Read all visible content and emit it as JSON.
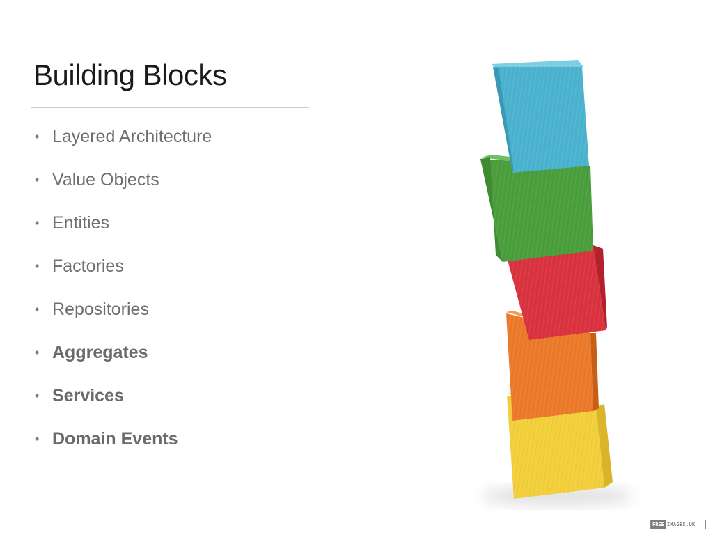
{
  "slide": {
    "title": "Building Blocks",
    "bullets": [
      {
        "text": "Layered Architecture",
        "bold": false
      },
      {
        "text": "Value Objects",
        "bold": false
      },
      {
        "text": "Entities",
        "bold": false
      },
      {
        "text": "Factories",
        "bold": false
      },
      {
        "text": "Repositories",
        "bold": false
      },
      {
        "text": "Aggregates",
        "bold": true
      },
      {
        "text": "Services",
        "bold": true
      },
      {
        "text": "Domain Events",
        "bold": true
      }
    ],
    "bullet_glyph": "•"
  },
  "image": {
    "subject": "stacked-wooden-blocks",
    "block_colors": [
      "#4bb3cf",
      "#4a9e3c",
      "#d9333f",
      "#ec7a2a",
      "#f2cf3b"
    ]
  },
  "watermark": {
    "left_text": "FREE",
    "right_text": "IMAGES.UK"
  }
}
